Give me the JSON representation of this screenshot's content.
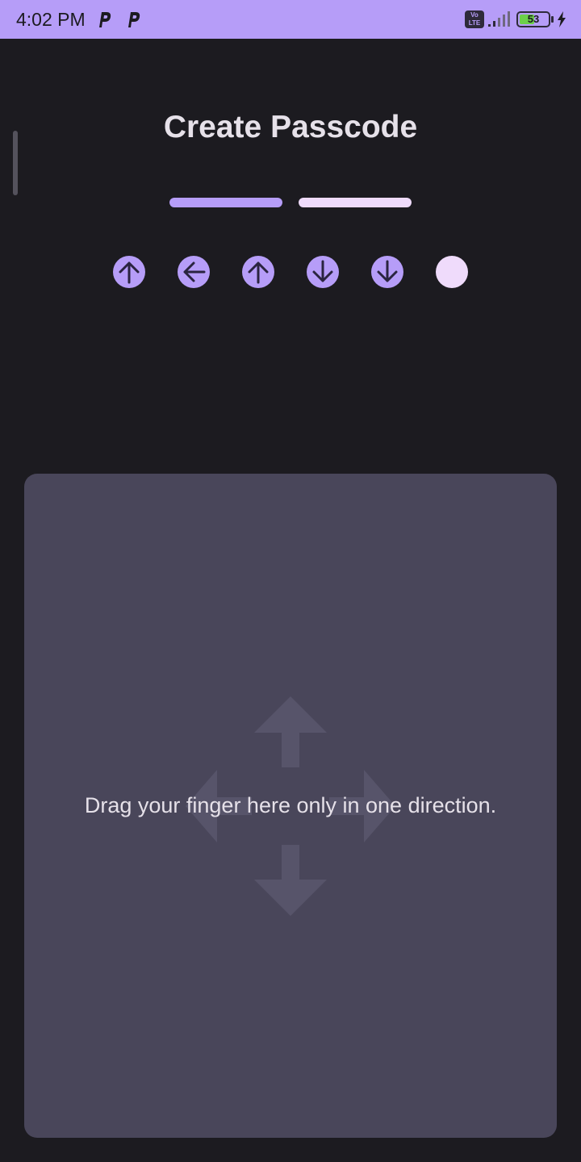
{
  "status_bar": {
    "time": "4:02 PM",
    "app_icons": [
      "p-app-icon",
      "p-app-icon"
    ],
    "network_badge": "Vo LTE",
    "battery_level": "53",
    "battery_fraction": 0.53,
    "charging": true,
    "background_color": "#b69df8"
  },
  "header": {
    "title": "Create Passcode"
  },
  "progress": {
    "steps": 2,
    "completed": 1,
    "active_color": "#b69df8",
    "inactive_color": "#efdbfb"
  },
  "passcode": {
    "entered": [
      "arrow-up-icon",
      "arrow-left-icon",
      "arrow-up-icon",
      "arrow-down-icon",
      "arrow-down-icon"
    ],
    "total_slots": 6
  },
  "gesture_pad": {
    "hint": "Drag your finger here only in one direction.",
    "background_color": "#49465a"
  },
  "colors": {
    "background": "#1c1b20",
    "accent": "#b69df8",
    "text": "#e6e1e9"
  }
}
